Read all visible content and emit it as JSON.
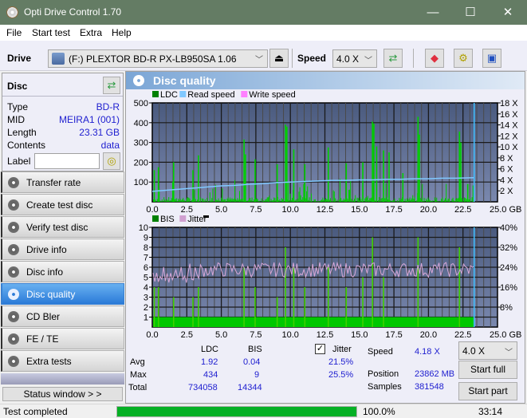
{
  "window": {
    "title": "Opti Drive Control 1.70",
    "minimize": "—",
    "maximize": "☐",
    "close": "✕"
  },
  "menu": [
    "File",
    "Start test",
    "Extra",
    "Help"
  ],
  "toolbar": {
    "drive_label": "Drive",
    "drive_value": "(F:)  PLEXTOR BD-R  PX-LB950SA 1.06",
    "speed_label": "Speed",
    "speed_value": "4.0 X",
    "icons": [
      "refresh-icon",
      "eraser-icon",
      "settings-icon",
      "save-icon"
    ]
  },
  "disc": {
    "header": "Disc",
    "type_label": "Type",
    "type_value": "BD-R",
    "mid_label": "MID",
    "mid_value": "MEIRA1 (001)",
    "length_label": "Length",
    "length_value": "23.31 GB",
    "contents_label": "Contents",
    "contents_value": "data",
    "label_label": "Label",
    "label_value": ""
  },
  "nav": [
    {
      "label": "Transfer rate",
      "active": false
    },
    {
      "label": "Create test disc",
      "active": false
    },
    {
      "label": "Verify test disc",
      "active": false
    },
    {
      "label": "Drive info",
      "active": false
    },
    {
      "label": "Disc info",
      "active": false
    },
    {
      "label": "Disc quality",
      "active": true
    },
    {
      "label": "CD Bler",
      "active": false
    },
    {
      "label": "FE / TE",
      "active": false
    },
    {
      "label": "Extra tests",
      "active": false
    }
  ],
  "status_window_btn": "Status window > >",
  "main": {
    "title": "Disc quality"
  },
  "chart_data": [
    {
      "type": "bar",
      "title": "LDC",
      "legend": [
        "LDC",
        "Read speed",
        "Write speed"
      ],
      "legend_colors": [
        "#008000",
        "#80c8ff",
        "#ff80ff"
      ],
      "xlabel": "GB",
      "xlim": [
        0,
        25
      ],
      "xticks": [
        "0.0",
        "2.5",
        "5.0",
        "7.5",
        "10.0",
        "12.5",
        "15.0",
        "17.5",
        "20.0",
        "22.5",
        "25.0 GB"
      ],
      "ylim": [
        0,
        500
      ],
      "yticks": [
        "100",
        "200",
        "300",
        "400",
        "500"
      ],
      "y2lim": [
        0,
        18
      ],
      "y2ticks": [
        "2 X",
        "4 X",
        "6 X",
        "8 X",
        "10 X",
        "12 X",
        "14 X",
        "16 X",
        "18 X"
      ],
      "grid": true,
      "end_marker_x": 23.31,
      "ldc_peaks": [
        [
          0.1,
          160
        ],
        [
          0.4,
          175
        ],
        [
          1.5,
          200
        ],
        [
          2.9,
          160
        ],
        [
          3.3,
          235
        ],
        [
          6.6,
          315
        ],
        [
          6.7,
          240
        ],
        [
          7.4,
          215
        ],
        [
          9.0,
          190
        ],
        [
          9.6,
          390
        ],
        [
          9.7,
          380
        ],
        [
          10.2,
          265
        ],
        [
          11.0,
          190
        ],
        [
          12.7,
          275
        ],
        [
          14.0,
          195
        ],
        [
          15.2,
          200
        ],
        [
          15.9,
          405
        ],
        [
          16.0,
          395
        ],
        [
          16.2,
          280
        ],
        [
          16.7,
          260
        ],
        [
          17.1,
          250
        ],
        [
          18.1,
          145
        ],
        [
          19.2,
          430
        ],
        [
          19.3,
          340
        ],
        [
          22.2,
          355
        ],
        [
          22.3,
          300
        ],
        [
          22.8,
          90
        ]
      ],
      "read_speed": [
        [
          0,
          1.9
        ],
        [
          1,
          2.1
        ],
        [
          2,
          2.3
        ],
        [
          3,
          2.5
        ],
        [
          4,
          2.7
        ],
        [
          5,
          2.9
        ],
        [
          6,
          3.0
        ],
        [
          7,
          3.2
        ],
        [
          8,
          3.3
        ],
        [
          9,
          3.5
        ],
        [
          10,
          3.6
        ],
        [
          11,
          3.7
        ],
        [
          12,
          3.8
        ],
        [
          13,
          3.9
        ],
        [
          14,
          3.9
        ],
        [
          15,
          4.0
        ],
        [
          16,
          4.0
        ],
        [
          17,
          4.1
        ],
        [
          18,
          4.1
        ],
        [
          19,
          4.2
        ],
        [
          20,
          4.2
        ],
        [
          21,
          4.3
        ],
        [
          22,
          4.3
        ],
        [
          23.31,
          4.4
        ]
      ]
    },
    {
      "type": "bar",
      "title": "BIS",
      "legend": [
        "BIS",
        "Jitter"
      ],
      "legend_colors": [
        "#008000",
        "#d0a0d0"
      ],
      "xlabel": "GB",
      "xlim": [
        0,
        25
      ],
      "xticks": [
        "0.0",
        "2.5",
        "5.0",
        "7.5",
        "10.0",
        "12.5",
        "15.0",
        "17.5",
        "20.0",
        "22.5",
        "25.0 GB"
      ],
      "ylim": [
        0,
        10
      ],
      "yticks": [
        "1",
        "2",
        "3",
        "4",
        "5",
        "6",
        "7",
        "8",
        "9",
        "10"
      ],
      "y2lim": [
        0,
        40
      ],
      "y2ticks": [
        "8%",
        "16%",
        "24%",
        "32%",
        "40%"
      ],
      "grid": true,
      "bis_baseline": 1,
      "bis_peaks": [
        [
          0.1,
          4
        ],
        [
          0.4,
          4
        ],
        [
          1.5,
          3
        ],
        [
          2.9,
          3
        ],
        [
          3.3,
          4
        ],
        [
          6.6,
          6
        ],
        [
          7.4,
          4
        ],
        [
          9.0,
          3
        ],
        [
          9.6,
          8
        ],
        [
          10.2,
          6
        ],
        [
          11.0,
          4
        ],
        [
          12.7,
          6
        ],
        [
          14.0,
          4
        ],
        [
          15.2,
          5
        ],
        [
          15.9,
          9
        ],
        [
          16.7,
          5
        ],
        [
          19.2,
          9
        ],
        [
          22.2,
          8
        ]
      ],
      "jitter_range_pct": [
        17,
        26
      ]
    }
  ],
  "stats": {
    "col_ldc": "LDC",
    "col_bis": "BIS",
    "col_jitter": "Jitter",
    "jitter_checked": true,
    "rows": [
      {
        "label": "Avg",
        "ldc": "1.92",
        "bis": "0.04",
        "jitter": "21.5%"
      },
      {
        "label": "Max",
        "ldc": "434",
        "bis": "9",
        "jitter": "25.5%"
      },
      {
        "label": "Total",
        "ldc": "734058",
        "bis": "14344",
        "jitter": ""
      }
    ],
    "speed_label": "Speed",
    "speed_value": "4.18 X",
    "position_label": "Position",
    "position_value": "23862 MB",
    "samples_label": "Samples",
    "samples_value": "381548",
    "speed_select": "4.0 X",
    "start_full": "Start full",
    "start_part": "Start part"
  },
  "statusbar": {
    "text": "Test completed",
    "progress": 1.0,
    "progress_text": "100.0%",
    "time": "33:14"
  }
}
